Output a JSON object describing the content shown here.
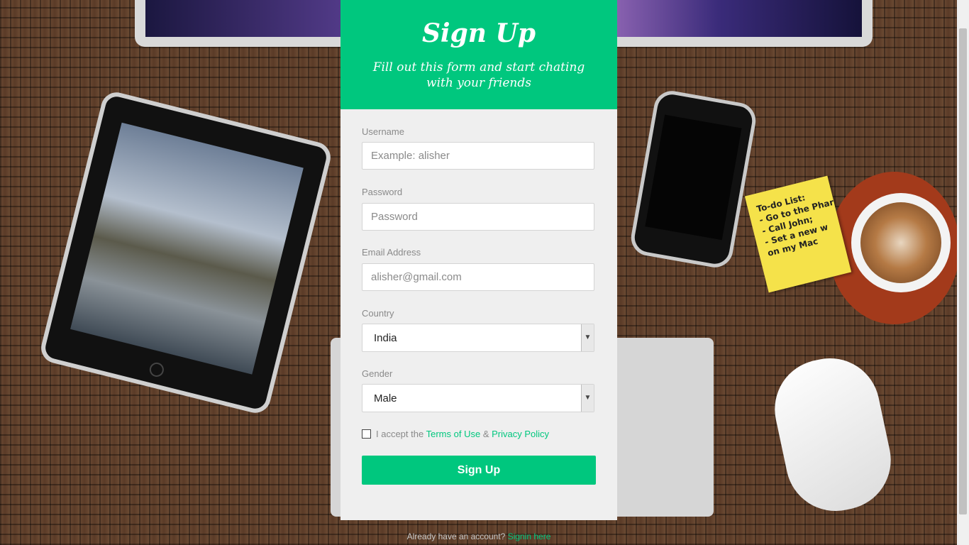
{
  "header": {
    "title": "Sign Up",
    "subtitle": "Fill out this form and start chating with your friends"
  },
  "form": {
    "username": {
      "label": "Username",
      "placeholder": "Example: alisher",
      "value": ""
    },
    "password": {
      "label": "Password",
      "placeholder": "Password",
      "value": ""
    },
    "email": {
      "label": "Email Address",
      "placeholder": "alisher@gmail.com",
      "value": ""
    },
    "country": {
      "label": "Country",
      "selected": "India"
    },
    "gender": {
      "label": "Gender",
      "selected": "Male"
    },
    "terms": {
      "checked": false,
      "prefix": "I accept the",
      "terms_link": "Terms of Use",
      "separator": "&",
      "privacy_link": "Privacy Policy"
    },
    "submit_label": "Sign Up"
  },
  "footer": {
    "text": "Already have an account?",
    "link": "Signin here"
  },
  "background": {
    "note_title": "To-do List:",
    "note_lines": [
      "- Go to the Phar",
      "- Call John;",
      "- Set a new w",
      "  on my Mac"
    ]
  },
  "colors": {
    "accent": "#00c77e",
    "panel": "#efefef"
  }
}
